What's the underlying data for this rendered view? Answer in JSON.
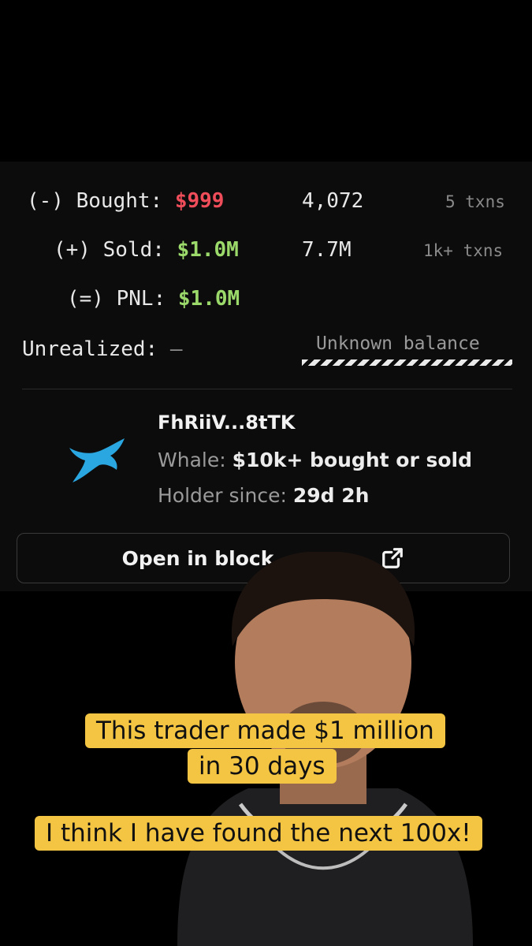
{
  "stats": {
    "bought": {
      "label": "(-) Bought:",
      "value": "$999",
      "amount": "4,072",
      "txns": "5 txns"
    },
    "sold": {
      "label": "(+) Sold:",
      "value": "$1.0M",
      "amount": "7.7M",
      "txns": "1k+ txns"
    },
    "pnl": {
      "label": "(=) PNL:",
      "value": "$1.0M"
    },
    "unrealized": {
      "label": "Unrealized:",
      "value": "–",
      "balance": "Unknown balance"
    }
  },
  "wallet": {
    "address": "FhRiiV...8tTK",
    "type_label": "Whale:",
    "type_value": "$10k+ bought or sold",
    "holder_label": "Holder since:",
    "holder_value": "29d 2h",
    "icon": "whale-icon"
  },
  "button": {
    "label": "Open in block",
    "icon": "external-link-icon"
  },
  "captions": {
    "line1": "This trader made $1 million",
    "line2": "in 30 days",
    "line3": "I think I have found the next 100x!"
  },
  "colors": {
    "negative": "#ef4d5a",
    "positive": "#9bd96b",
    "caption_bg": "#f4c542",
    "whale": "#2aa7e0"
  }
}
